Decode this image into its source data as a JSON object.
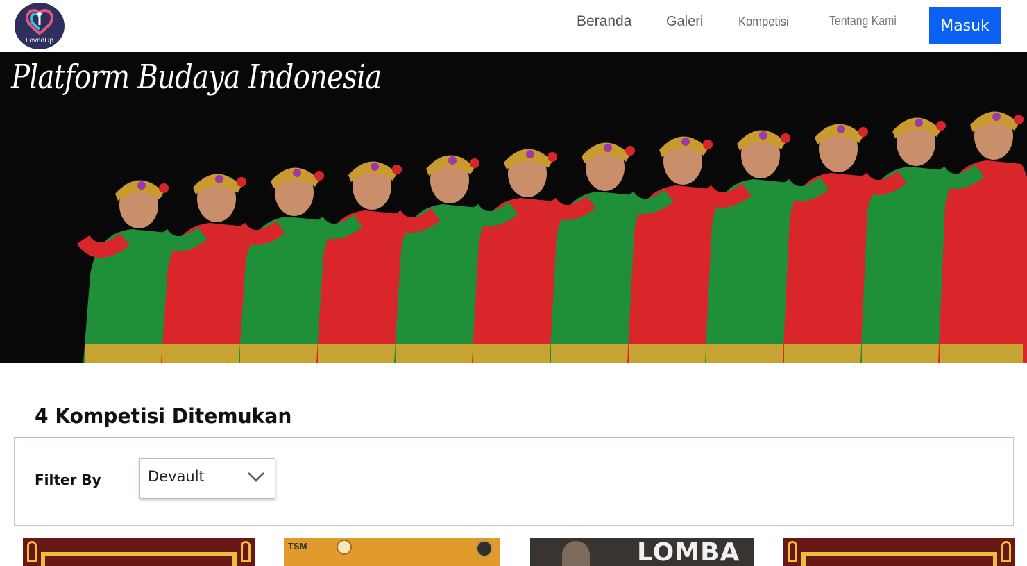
{
  "nav": {
    "logo_text": "LovedUp",
    "links": [
      "Beranda",
      "Galeri",
      "Kompetisi",
      "Tentang Kami"
    ],
    "login_label": "Masuk",
    "accent_color": "#0b62f2"
  },
  "hero": {
    "title": "Platform Budaya Indonesia",
    "image": "traditional-dancers-photo"
  },
  "results": {
    "heading": "4 Kompetisi Ditemukan",
    "filter_label": "Filter By",
    "filter_value": "Devault"
  },
  "cards": [
    {
      "image": "competition-poster-ornament"
    },
    {
      "image": "tsm-competition-poster",
      "logo": "TSM"
    },
    {
      "image": "lomba-poster",
      "text": "LOMBA"
    },
    {
      "image": "competition-poster-ornament"
    }
  ]
}
